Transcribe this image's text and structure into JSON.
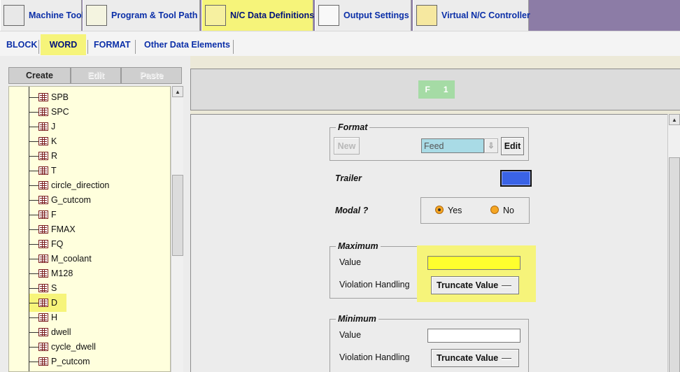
{
  "top_tabs": [
    {
      "label": "Machine Tool",
      "icon": "machine-tool-icon"
    },
    {
      "label": "Program & Tool Path",
      "icon": "program-tool-path-icon"
    },
    {
      "label": "N/C Data Definitions",
      "icon": "nc-data-icon"
    },
    {
      "label": "Output Settings",
      "icon": "printer-icon"
    },
    {
      "label": "Virtual N/C Controller",
      "icon": "virtual-controller-icon"
    }
  ],
  "sub_tabs": [
    "BLOCK",
    "WORD",
    "FORMAT",
    "Other Data Elements"
  ],
  "tree_toolbar": {
    "create": "Create",
    "edit": "Edit",
    "paste": "Paste"
  },
  "tree_items": [
    "SPB",
    "SPC",
    "J",
    "K",
    "R",
    "T",
    "circle_direction",
    "G_cutcom",
    "F",
    "FMAX",
    "FQ",
    "M_coolant",
    "M128",
    "S",
    "D",
    "H",
    "dwell",
    "cycle_dwell",
    "P_cutcom"
  ],
  "header_chip": {
    "letter": "F",
    "number": "1"
  },
  "format_group": {
    "title": "Format",
    "new_button": "New",
    "feed_value": "Feed",
    "edit_button": "Edit"
  },
  "trailer": {
    "label": "Trailer"
  },
  "modal": {
    "label": "Modal ?",
    "yes": "Yes",
    "no": "No",
    "selected": "Yes"
  },
  "maximum_group": {
    "title": "Maximum",
    "value_label": "Value",
    "value": "",
    "violation_label": "Violation Handling",
    "violation_value": "Truncate Value"
  },
  "minimum_group": {
    "title": "Minimum",
    "value_label": "Value",
    "value": "",
    "violation_label": "Violation Handling",
    "violation_value": "Truncate Value"
  },
  "colors": {
    "highlight": "#f6f47a",
    "tab_text": "#0b2fa8",
    "trailer_swatch": "#3a63e6",
    "chip_bg": "#a5dba5",
    "feed_field_bg": "#a9dbe6"
  }
}
